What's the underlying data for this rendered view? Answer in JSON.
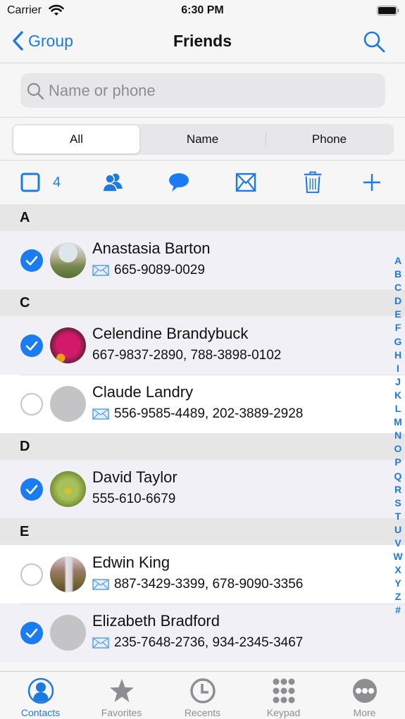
{
  "status_bar": {
    "carrier": "Carrier",
    "time": "6:30 PM"
  },
  "nav": {
    "back_label": "Group",
    "title": "Friends"
  },
  "search": {
    "placeholder": "Name or phone",
    "value": ""
  },
  "segments": [
    {
      "label": "All",
      "active": true
    },
    {
      "label": "Name",
      "active": false
    },
    {
      "label": "Phone",
      "active": false
    }
  ],
  "toolbar": {
    "selected_count": "4",
    "actions": [
      "select-all",
      "group",
      "message",
      "email",
      "delete",
      "add"
    ]
  },
  "colors": {
    "accent": "#1f7ae0",
    "check": "#1a7cf0",
    "section_bg": "#e6e6e7",
    "selected_row_bg": "#f1f0f6"
  },
  "sections": [
    {
      "letter": "A",
      "contacts": [
        {
          "name": "Anastasia Barton",
          "phone": "665-9089-0029",
          "has_email": true,
          "selected": true,
          "avatar": "photo-garden"
        }
      ]
    },
    {
      "letter": "C",
      "contacts": [
        {
          "name": "Celendine Brandybuck",
          "phone": "667-9837-2890, 788-3898-0102",
          "has_email": false,
          "selected": true,
          "avatar": "photo-flowers"
        },
        {
          "name": "Claude Landry",
          "phone": "556-9585-4489, 202-3889-2928",
          "has_email": true,
          "selected": false,
          "avatar": "placeholder"
        }
      ]
    },
    {
      "letter": "D",
      "contacts": [
        {
          "name": "David Taylor",
          "phone": "555-610-6679",
          "has_email": false,
          "selected": true,
          "avatar": "photo-leaves"
        }
      ]
    },
    {
      "letter": "E",
      "contacts": [
        {
          "name": "Edwin King",
          "phone": "887-3429-3399, 678-9090-3356",
          "has_email": true,
          "selected": false,
          "avatar": "photo-waterfall"
        },
        {
          "name": "Elizabeth Bradford",
          "phone": "235-7648-2736, 934-2345-3467",
          "has_email": true,
          "selected": true,
          "avatar": "placeholder"
        }
      ]
    }
  ],
  "index_letters": [
    "A",
    "B",
    "C",
    "D",
    "E",
    "F",
    "G",
    "H",
    "I",
    "J",
    "K",
    "L",
    "M",
    "N",
    "O",
    "P",
    "Q",
    "R",
    "S",
    "T",
    "U",
    "V",
    "W",
    "X",
    "Y",
    "Z",
    "#"
  ],
  "tabs": [
    {
      "label": "Contacts",
      "icon": "person-circle-icon",
      "active": true
    },
    {
      "label": "Favorites",
      "icon": "star-icon",
      "active": false
    },
    {
      "label": "Recents",
      "icon": "clock-icon",
      "active": false
    },
    {
      "label": "Keypad",
      "icon": "keypad-icon",
      "active": false
    },
    {
      "label": "More",
      "icon": "more-icon",
      "active": false
    }
  ]
}
